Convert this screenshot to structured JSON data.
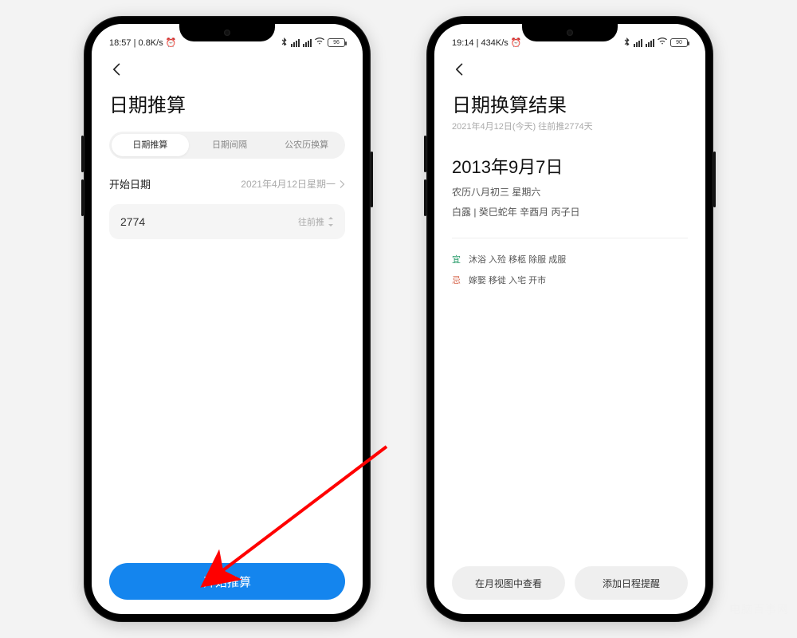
{
  "left": {
    "status": {
      "time": "18:57",
      "net": "0.8K/s",
      "battery": "96"
    },
    "title": "日期推算",
    "tabs": [
      "日期推算",
      "日期间隔",
      "公农历换算"
    ],
    "active_tab": 0,
    "start_label": "开始日期",
    "start_value": "2021年4月12日星期一",
    "days_value": "2774",
    "direction": "往前推",
    "primary": "开始推算"
  },
  "right": {
    "status": {
      "time": "19:14",
      "net": "434K/s",
      "battery": "90"
    },
    "title": "日期换算结果",
    "subtitle": "2021年4月12日(今天) 往前推2774天",
    "result_date": "2013年9月7日",
    "lunar": "农历八月初三 星期六",
    "ganzhi": "白露 | 癸巳蛇年 辛酉月 丙子日",
    "yi_label": "宜",
    "yi_text": "沐浴 入殓 移柩 除服 成服",
    "ji_label": "忌",
    "ji_text": "嫁娶 移徙 入宅 开市",
    "btn_view": "在月视图中查看",
    "btn_remind": "添加日程提醒"
  },
  "watermark": "电脑百事网"
}
